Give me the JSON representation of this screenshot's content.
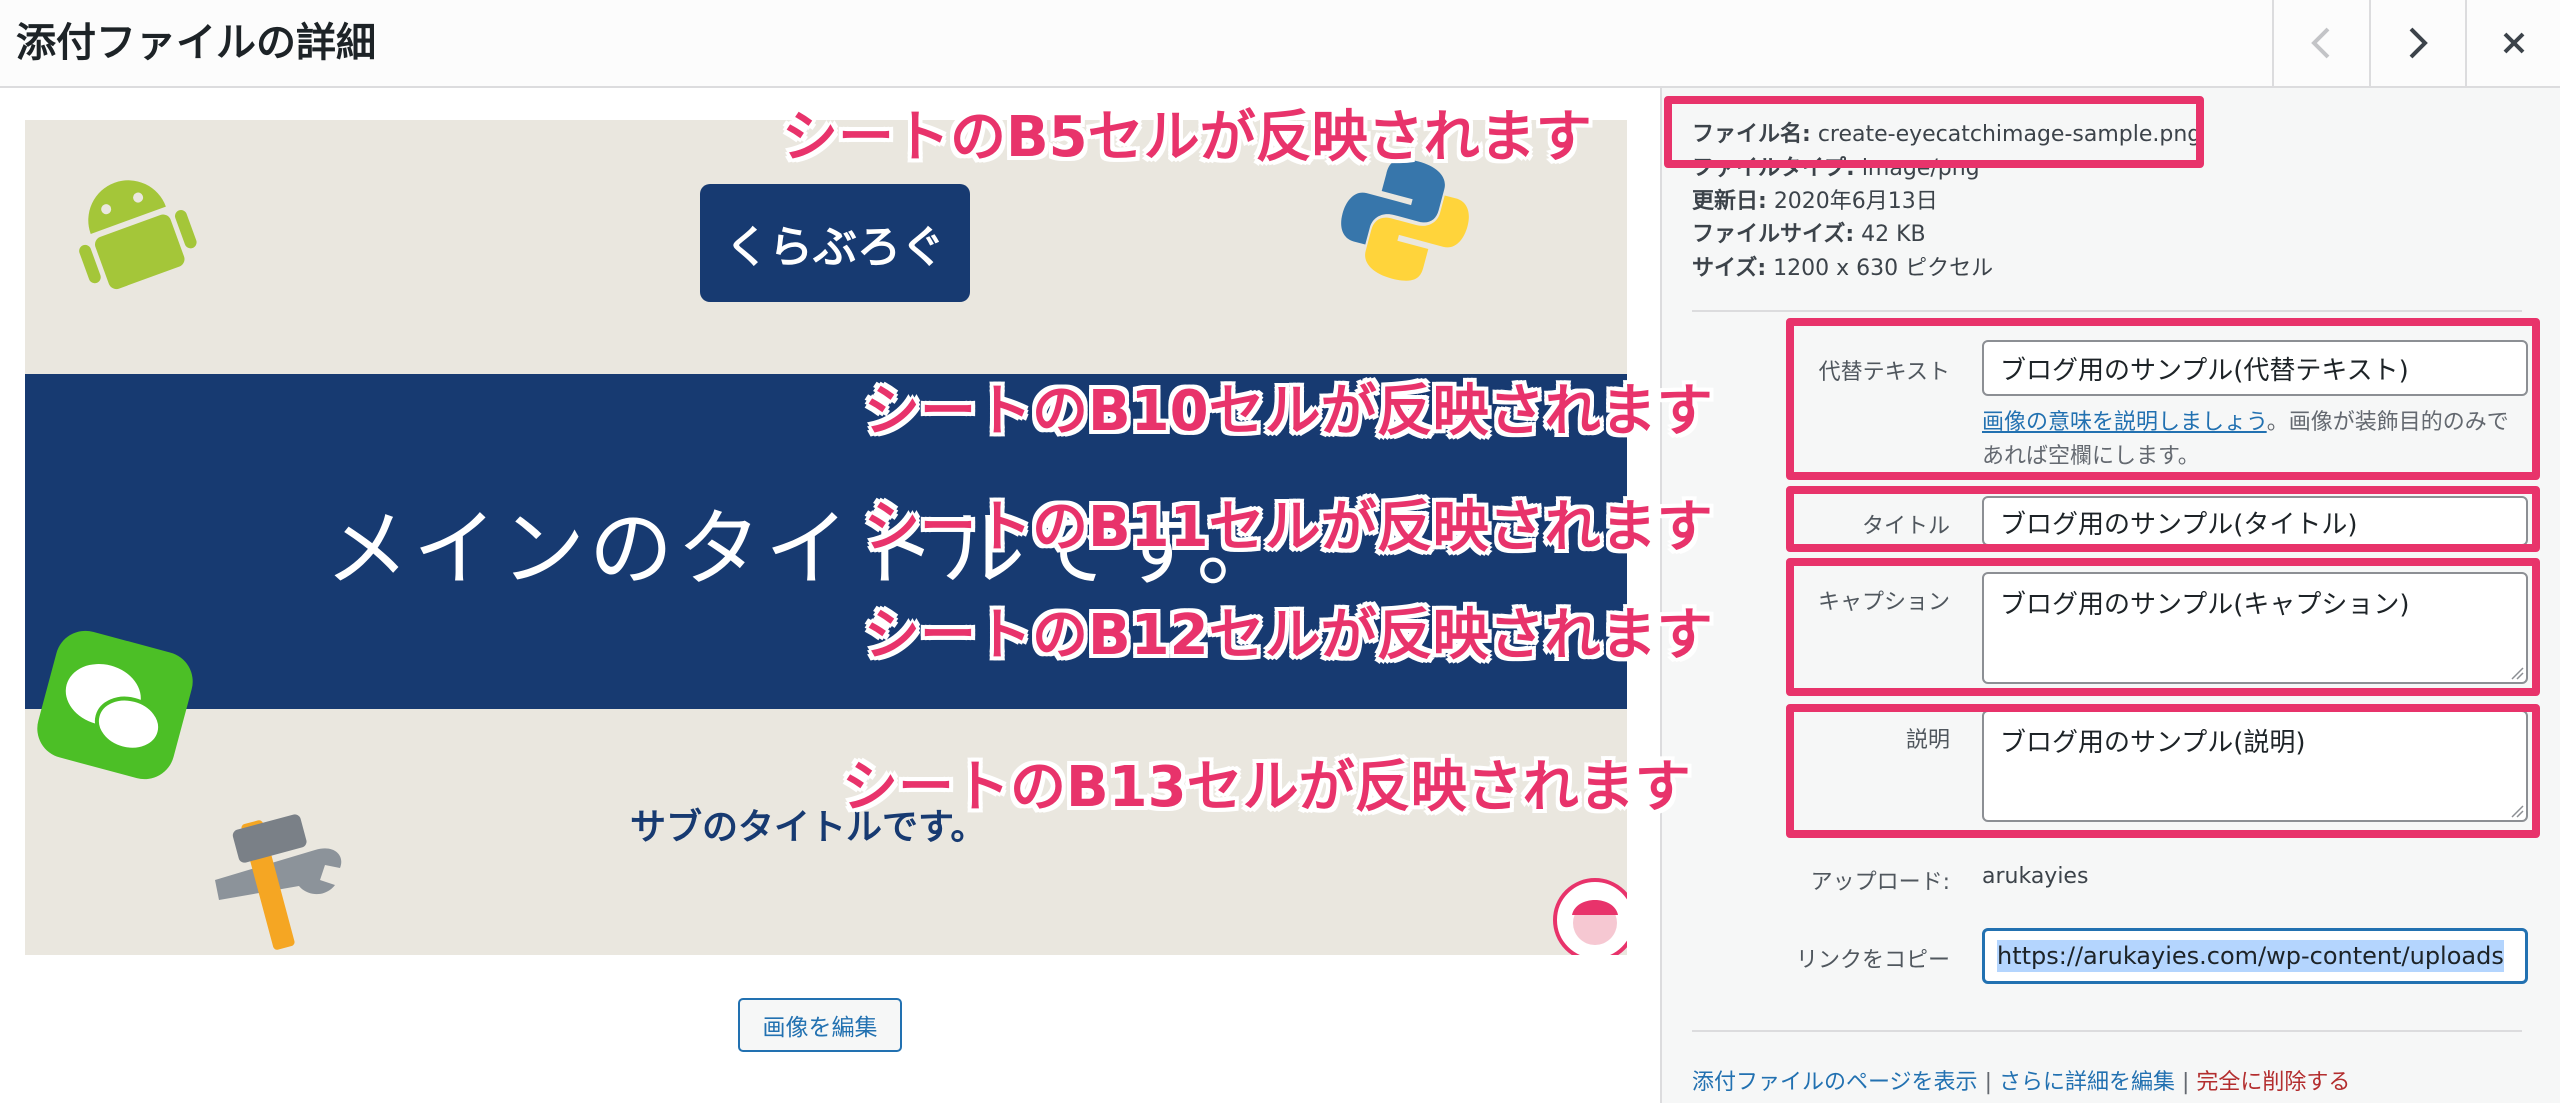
{
  "header": {
    "title": "添付ファイルの詳細",
    "prev_icon": "chevron-left-icon",
    "next_icon": "chevron-right-icon",
    "close_icon": "close-icon"
  },
  "preview": {
    "logo_text": "くらぶろぐ",
    "main_title": "メインのタイトルです。",
    "sub_title": "サブのタイトルです。",
    "banner_color": "#173a71",
    "edit_button": "画像を編集"
  },
  "file_info": {
    "filename_label": "ファイル名:",
    "filename_value": "create-eyecatchimage-sample.png",
    "filetype_label": "ファイルタイプ:",
    "filetype_value": "image/png",
    "updated_label": "更新日:",
    "updated_value": "2020年6月13日",
    "filesize_label": "ファイルサイズ:",
    "filesize_value": "42 KB",
    "dimensions_label": "サイズ:",
    "dimensions_value": "1200 x 630 ピクセル"
  },
  "fields": {
    "alt_label": "代替テキスト",
    "alt_value": "ブログ用のサンプル(代替テキスト)",
    "alt_help_link": "画像の意味を説明しましょう",
    "alt_help_rest": "。画像が装飾目的のみであれば空欄にします。",
    "title_label": "タイトル",
    "title_value": "ブログ用のサンプル(タイトル)",
    "caption_label": "キャプション",
    "caption_value": "ブログ用のサンプル(キャプション)",
    "description_label": "説明",
    "description_value": "ブログ用のサンプル(説明)",
    "uploader_label": "アップロード:",
    "uploader_value": "arukayies",
    "copy_link_label": "リンクをコピー",
    "copy_link_value": "https://arukayies.com/wp-content/uploads"
  },
  "actions": {
    "view_page": "添付ファイルのページを表示",
    "edit_more": "さらに詳細を編集",
    "delete": "完全に削除する",
    "separator": "|"
  },
  "annotations": {
    "b5": "シートのB5セルが反映されます",
    "b10": "シートのB10セルが反映されます",
    "b11": "シートのB11セルが反映されます",
    "b12": "シートのB12セルが反映されます",
    "b13": "シートのB13セルが反映されます"
  },
  "colors": {
    "annotation": "#e8336b",
    "link": "#2271b1",
    "danger": "#b32d2e"
  }
}
